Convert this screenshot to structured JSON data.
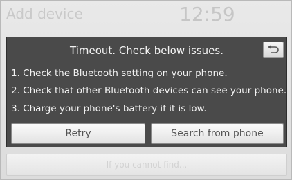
{
  "header": {
    "title": "Add device",
    "clock": "12:59"
  },
  "dialog": {
    "title": "Timeout. Check below issues.",
    "back_icon": "back-arrow-icon",
    "lines": [
      "1. Check the Bluetooth setting on your phone.",
      "2. Check that other Bluetooth devices can see your phone.",
      "3. Charge your phone's battery if it is low."
    ],
    "retry_label": "Retry",
    "search_label": "Search from phone"
  },
  "bottom": {
    "label": "If you cannot find..."
  }
}
